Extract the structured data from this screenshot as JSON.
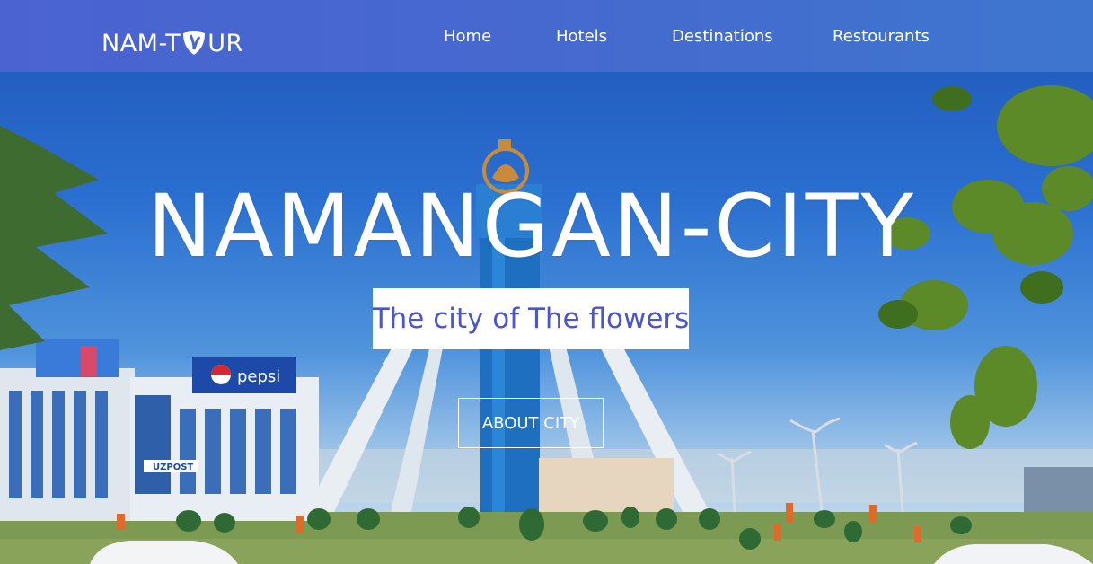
{
  "header": {
    "logo_text_left": "NAM-T",
    "logo_text_right": "UR",
    "logo_icon": "tour-emblem-icon",
    "nav": [
      {
        "label": "Home"
      },
      {
        "label": "Hotels"
      },
      {
        "label": "Destinations"
      },
      {
        "label": "Restourants"
      }
    ]
  },
  "hero": {
    "title": "NAMANGAN-CITY",
    "subtitle": "The city of The flowers",
    "button_label": "ABOUT CITY",
    "background_signs": {
      "pepsi": "pepsi",
      "post": "UZPOST"
    }
  },
  "colors": {
    "header": "#4669cf",
    "subtitle_text": "#4a55cf",
    "white": "#ffffff"
  }
}
